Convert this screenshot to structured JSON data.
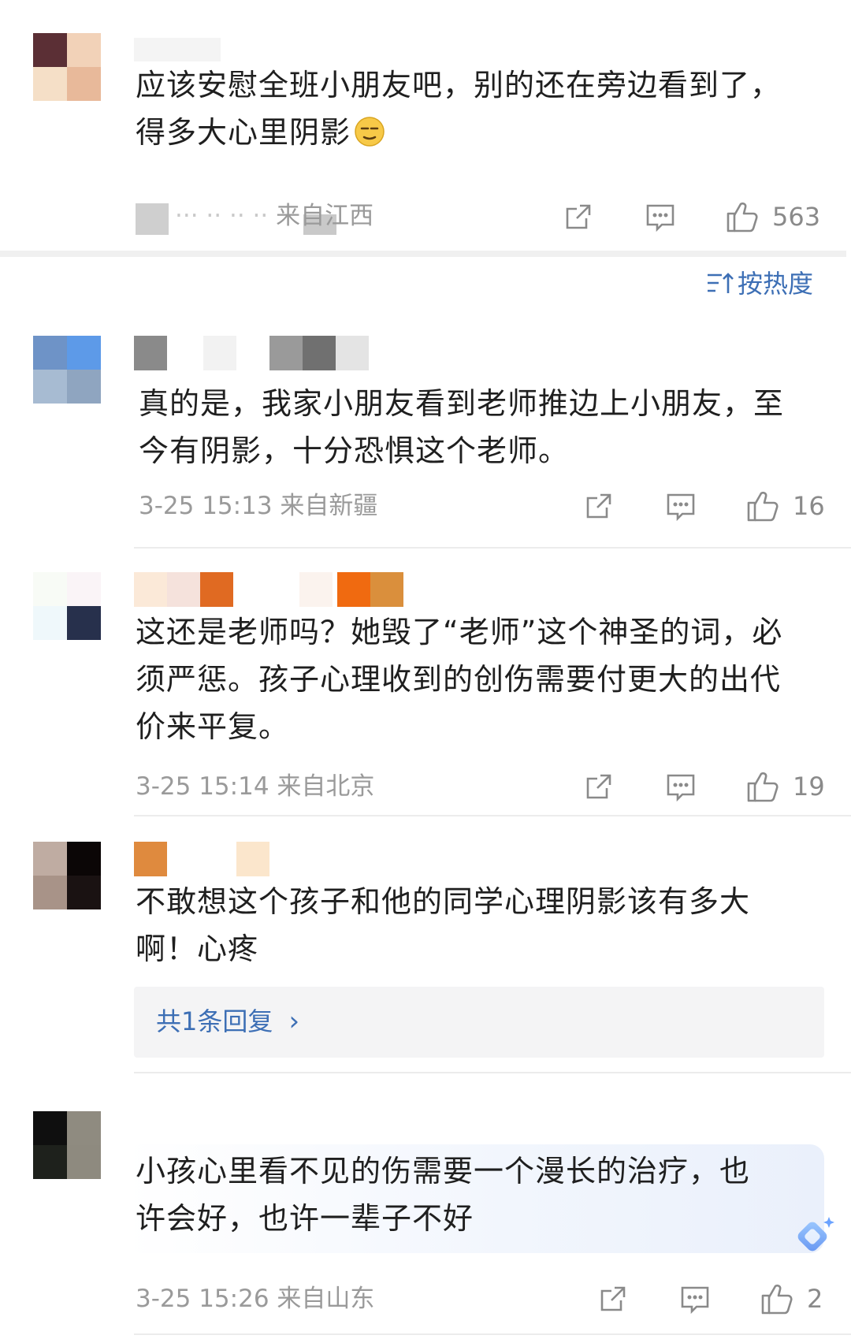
{
  "sort": {
    "label": "按热度"
  },
  "comments": [
    {
      "text_lines": [
        "应该安慰全班小朋友吧，别的还在旁边看到了，",
        "得多大心里阴影"
      ],
      "emoji": "pensive-face",
      "meta": "来自江西",
      "likes": "563"
    },
    {
      "text_lines": [
        "真的是，我家小朋友看到老师推边上小朋友，至",
        "今有阴影，十分恐惧这个老师。"
      ],
      "meta": "3-25 15:13 来自新疆",
      "likes": "16"
    },
    {
      "text_lines": [
        "这还是老师吗？她毁了“老师”这个神圣的词，必",
        "须严惩。孩子心理收到的创伤需要付更大的出代",
        "价来平复。"
      ],
      "meta": "3-25 15:14 来自北京",
      "likes": "19"
    },
    {
      "text_lines": [
        "不敢想这个孩子和他的同学心理阴影该有多大",
        "啊！心疼"
      ],
      "reply": "共1条回复",
      "reply_arrow": "›"
    },
    {
      "text_lines": [
        "小孩心里看不见的伤需要一个漫长的治疗，也",
        "许会好，也许一辈子不好"
      ],
      "meta": "3-25 15:26 来自山东",
      "likes": "2"
    }
  ],
  "icons": {
    "share": "share-icon",
    "comment": "comment-icon",
    "like": "thumbs-up-icon",
    "sort": "sort-icon",
    "ai": "ai-sparkle-icon"
  },
  "colors": {
    "accent": "#3d6fb5",
    "meta": "#9a9a9a"
  }
}
